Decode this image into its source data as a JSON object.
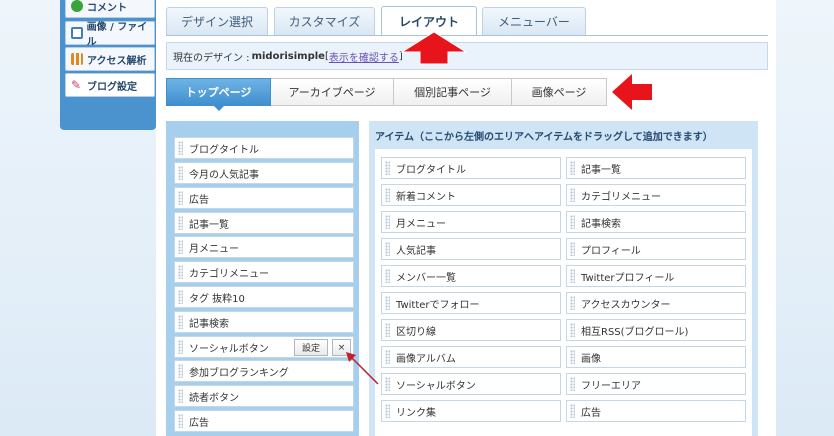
{
  "sidebar": {
    "items": [
      {
        "label": "コメント",
        "icon": "comment-icon",
        "color": "#3aa33a"
      },
      {
        "label": "画像 / ファイル",
        "icon": "image-file-icon",
        "color": "#3f7fbf"
      },
      {
        "label": "アクセス解析",
        "icon": "bar-chart-icon",
        "color": "#e08a1e"
      },
      {
        "label": "ブログ設定",
        "icon": "wrench-icon",
        "color": "#d23b6a"
      }
    ]
  },
  "tabs": [
    {
      "label": "デザイン選択"
    },
    {
      "label": "カスタマイズ"
    },
    {
      "label": "レイアウト",
      "active": true
    },
    {
      "label": "メニューバー"
    }
  ],
  "design_bar": {
    "prefix": "現在のデザイン : ",
    "name": "midorisimple",
    "link_open": "[",
    "link": "表示を確認する",
    "link_close": "]"
  },
  "sub_tabs": [
    {
      "label": "トップページ",
      "active": true
    },
    {
      "label": "アーカイブページ"
    },
    {
      "label": "個別記事ページ"
    },
    {
      "label": "画像ページ"
    }
  ],
  "placed_items": [
    {
      "label": "ブログタイトル"
    },
    {
      "label": "今月の人気記事"
    },
    {
      "label": "広告"
    },
    {
      "label": "記事一覧"
    },
    {
      "label": "月メニュー"
    },
    {
      "label": "カテゴリメニュー"
    },
    {
      "label": "タグ 抜粋10"
    },
    {
      "label": "記事検索"
    },
    {
      "label": "ソーシャルボタン",
      "settings": "設定",
      "remove": "×"
    },
    {
      "label": "参加ブログランキング"
    },
    {
      "label": "読者ボタン"
    },
    {
      "label": "広告"
    }
  ],
  "available": {
    "title": "アイテム（ここから左側のエリアへアイテムをドラッグして追加できます）",
    "items": [
      {
        "label": "ブログタイトル"
      },
      {
        "label": "記事一覧"
      },
      {
        "label": "新着コメント"
      },
      {
        "label": "カテゴリメニュー"
      },
      {
        "label": "月メニュー"
      },
      {
        "label": "記事検索"
      },
      {
        "label": "人気記事"
      },
      {
        "label": "プロフィール"
      },
      {
        "label": "メンバー一覧"
      },
      {
        "label": "Twitterプロフィール"
      },
      {
        "label": "Twitterでフォロー"
      },
      {
        "label": "アクセスカウンター"
      },
      {
        "label": "区切り線"
      },
      {
        "label": "相互RSS(ブログロール)"
      },
      {
        "label": "画像アルバム"
      },
      {
        "label": "画像"
      },
      {
        "label": "ソーシャルボタン"
      },
      {
        "label": "フリーエリア"
      },
      {
        "label": "リンク集"
      },
      {
        "label": "広告"
      }
    ]
  },
  "colors": {
    "accent": "#3f8fcf",
    "annotation": "#e8141c"
  }
}
